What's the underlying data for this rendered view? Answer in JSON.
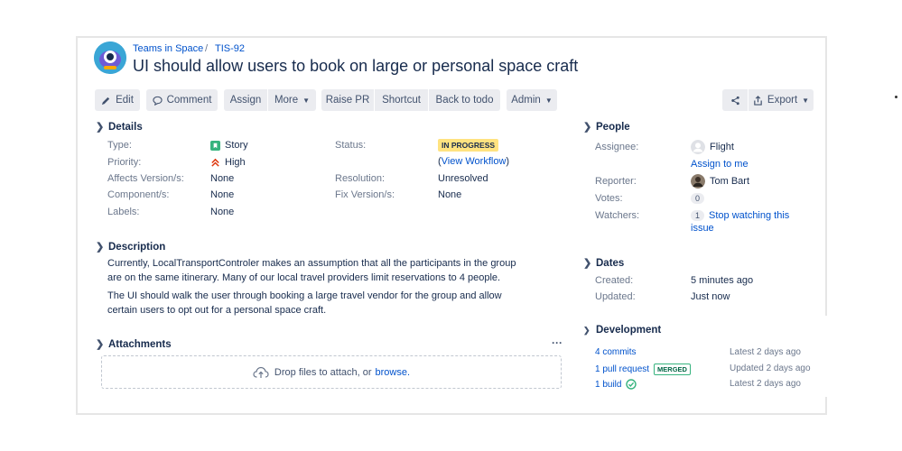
{
  "breadcrumb": {
    "project": "Teams in Space",
    "separator": "/",
    "issue_key": "TIS-92"
  },
  "issue": {
    "title": "UI should allow users to book on large or personal space craft"
  },
  "toolbar": {
    "edit": "Edit",
    "comment": "Comment",
    "assign": "Assign",
    "more": "More",
    "raise_pr": "Raise PR",
    "shortcut": "Shortcut",
    "back_to_todo": "Back to todo",
    "admin": "Admin",
    "export": "Export"
  },
  "details": {
    "heading": "Details",
    "type_label": "Type:",
    "type_value": "Story",
    "priority_label": "Priority:",
    "priority_value": "High",
    "affects_label": "Affects Version/s:",
    "affects_value": "None",
    "component_label": "Component/s:",
    "component_value": "None",
    "labels_label": "Labels:",
    "labels_value": "None",
    "status_label": "Status:",
    "status_value": "IN PROGRESS",
    "workflow_open": "(",
    "workflow_link": "View Workflow",
    "workflow_close": ")",
    "resolution_label": "Resolution:",
    "resolution_value": "Unresolved",
    "fix_label": "Fix Version/s:",
    "fix_value": "None"
  },
  "description": {
    "heading": "Description",
    "para1_line1": "Currently, LocalTransportControler makes an assumption that all the participants in the group",
    "para1_line2": "are on the same itinerary. Many of our local travel providers limit reservations to 4 people.",
    "para2_line1": "The UI should walk the user through booking a large travel vendor for the group and allow",
    "para2_line2": "certain users to opt out for a personal space craft."
  },
  "attachments": {
    "heading": "Attachments",
    "more": "···",
    "drop_text": "Drop files to attach, or",
    "browse": "browse."
  },
  "people": {
    "heading": "People",
    "assignee_label": "Assignee:",
    "assignee_value": "Flight",
    "assign_to_me": "Assign to me",
    "reporter_label": "Reporter:",
    "reporter_value": "Tom Bart",
    "votes_label": "Votes:",
    "votes_value": "0",
    "watchers_label": "Watchers:",
    "watchers_count": "1",
    "watch_line1": "Stop watching this",
    "watch_line2": "issue"
  },
  "dates": {
    "heading": "Dates",
    "created_label": "Created:",
    "created_value": "5 minutes ago",
    "updated_label": "Updated:",
    "updated_value": "Just now"
  },
  "development": {
    "heading": "Development",
    "commits": "4 commits",
    "commits_time": "Latest 2 days ago",
    "pull_request": "1 pull request",
    "merged": "MERGED",
    "pr_time": "Updated 2 days ago",
    "build": "1 build",
    "build_time": "Latest 2 days ago"
  },
  "colors": {
    "link": "#0052cc",
    "in_progress": "#ffe380",
    "story": "#36b37e",
    "high": "#de350b",
    "merged": "#36b37e"
  },
  "icons": [
    "edit-icon",
    "comment-icon",
    "chevron-down-icon",
    "share-icon",
    "export-icon",
    "story-icon",
    "priority-high-icon",
    "upload-cloud-icon",
    "build-success-icon"
  ]
}
